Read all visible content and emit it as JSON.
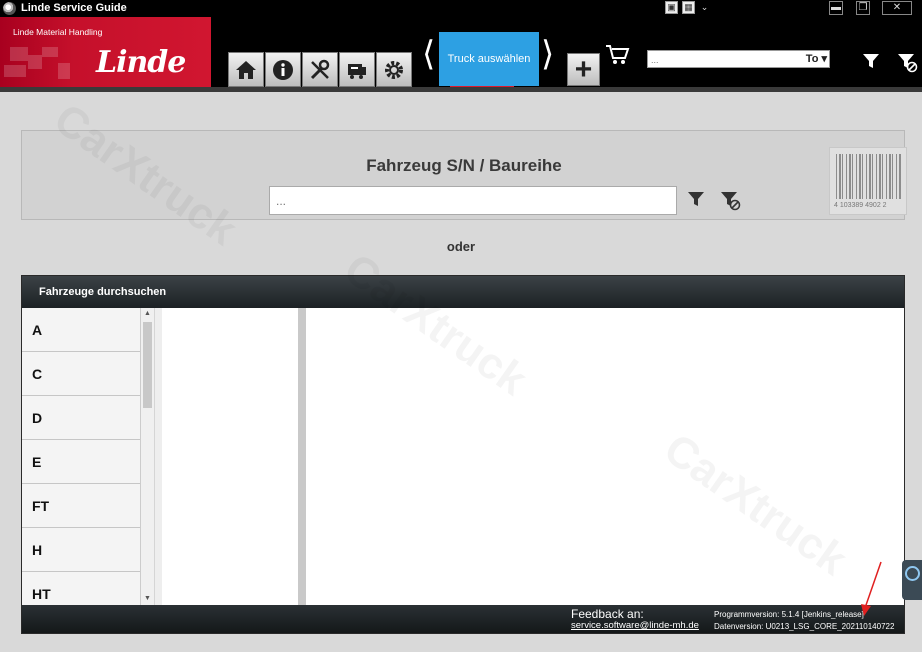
{
  "window": {
    "title": "Linde Service Guide",
    "icons": [
      "app-icon",
      "restore-icon",
      "close-icon",
      "grid-icon",
      "resize-icon",
      "dropdown-icon"
    ]
  },
  "header": {
    "brand_subtitle": "Linde Material Handling",
    "brand_name": "Linde",
    "nav_icons": [
      "home-icon",
      "info-icon",
      "tools-icon",
      "truck-service-icon",
      "gear-icon"
    ],
    "active_tab_label": "Truck auswählen",
    "add_icon": "plus-icon",
    "cart_icon": "cart-icon",
    "search_placeholder": "...",
    "search_mode": "To",
    "filter_icon": "filter-icon",
    "filter_clear_icon": "filter-clear-icon",
    "accent_color": "#2da0e3",
    "brand_color": "#c5102b"
  },
  "search_panel": {
    "title": "Fahrzeug S/N / Baureihe",
    "input_placeholder": "...",
    "barcode_number": "4 103389 4902 2"
  },
  "or_label": "oder",
  "browse": {
    "title": "Fahrzeuge durchsuchen",
    "letters": [
      "A",
      "C",
      "D",
      "E",
      "FT",
      "H",
      "HT"
    ],
    "feedback_label": "Feedback an:",
    "feedback_email": "service.software@linde-mh.de",
    "program_version": "Programmversion: 5.1.4 [Jenkins_release]",
    "data_version": "Datenversion: U0213_LSG_CORE_202110140722"
  }
}
